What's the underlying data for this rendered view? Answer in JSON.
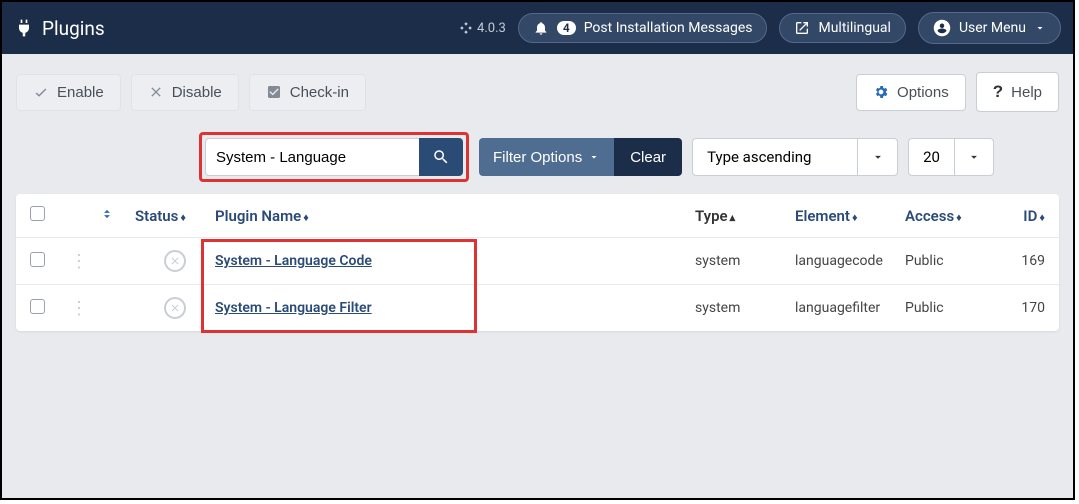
{
  "header": {
    "title": "Plugins",
    "version": "4.0.3",
    "notification_count": "4",
    "post_install": "Post Installation Messages",
    "multilingual": "Multilingual",
    "user_menu": "User Menu"
  },
  "toolbar": {
    "enable": "Enable",
    "disable": "Disable",
    "checkin": "Check-in",
    "options": "Options",
    "help": "Help"
  },
  "filter": {
    "search_value": "System - Language",
    "filter_options": "Filter Options",
    "clear": "Clear",
    "sort": "Type ascending",
    "limit": "20"
  },
  "table": {
    "headers": {
      "status": "Status",
      "name": "Plugin Name",
      "type": "Type",
      "element": "Element",
      "access": "Access",
      "id": "ID"
    },
    "rows": [
      {
        "name": "System - Language Code",
        "type": "system",
        "element": "languagecode",
        "access": "Public",
        "id": "169"
      },
      {
        "name": "System - Language Filter",
        "type": "system",
        "element": "languagefilter",
        "access": "Public",
        "id": "170"
      }
    ]
  }
}
